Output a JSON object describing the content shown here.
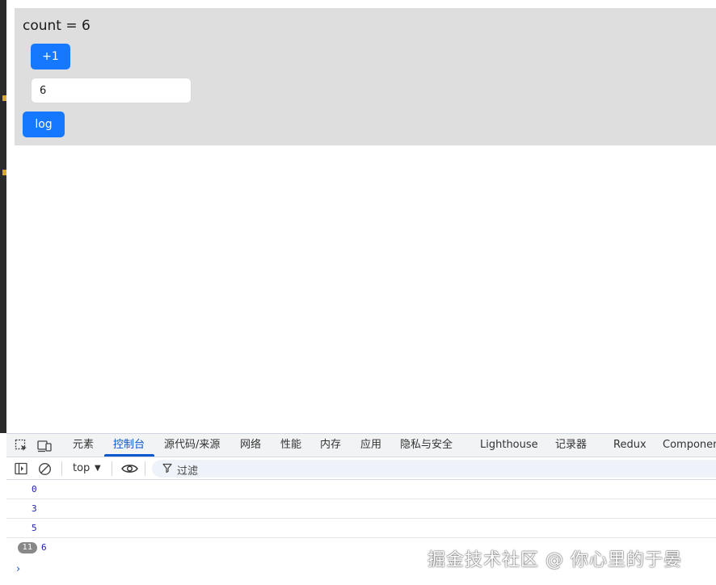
{
  "app": {
    "count_text": "count = 6",
    "plus_button": "+1",
    "input_value": "6",
    "log_button": "log"
  },
  "devtools": {
    "tabs": [
      "元素",
      "控制台",
      "源代码/来源",
      "网络",
      "性能",
      "内存",
      "应用",
      "隐私与安全",
      "Lighthouse",
      "记录器",
      "Redux",
      "Componen"
    ],
    "active_tab": "控制台",
    "context": "top",
    "filter_placeholder": "过滤",
    "logs": [
      {
        "value": "0"
      },
      {
        "value": "3"
      },
      {
        "value": "5"
      },
      {
        "badge": "11",
        "value": "6"
      }
    ],
    "prompt": "›"
  },
  "watermark": "掘金技术社区 @ 你心里的于晏",
  "colors": {
    "accent": "#1677ff",
    "devtools_active": "#0b57d0",
    "log_number": "#1a1aa6",
    "app_bg": "#dedede"
  }
}
